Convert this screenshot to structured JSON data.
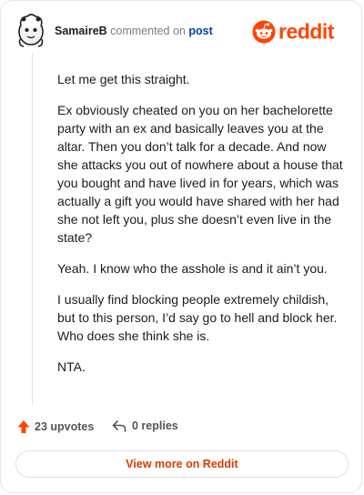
{
  "header": {
    "username": "SamaireB",
    "commented_text": "commented on",
    "post_link": "post",
    "brand": "reddit",
    "brand_color": "#ff4500"
  },
  "comment": {
    "paragraphs": [
      "Let me get this straight.",
      "Ex obviously cheated on you on her bachelorette party with an ex and basically leaves you at the altar. Then you don’t talk for a decade. And now she attacks you out of nowhere about a house that you bought and have lived in for years, which was actually a gift you would have shared with her had she not left you, plus she doesn’t even live in the state?",
      "Yeah. I know who the asshole is and it ain’t you.",
      "I usually find blocking people extremely childish, but to this person, I’d say go to hell and block her. Who does she think she is.",
      "NTA."
    ]
  },
  "footer": {
    "upvotes": "23 upvotes",
    "replies": "0 replies",
    "upvote_icon": "arrow-up-icon",
    "reply_icon": "reply-arrow-icon"
  },
  "view_more_label": "View more on Reddit",
  "accent_color": "#d93a00"
}
